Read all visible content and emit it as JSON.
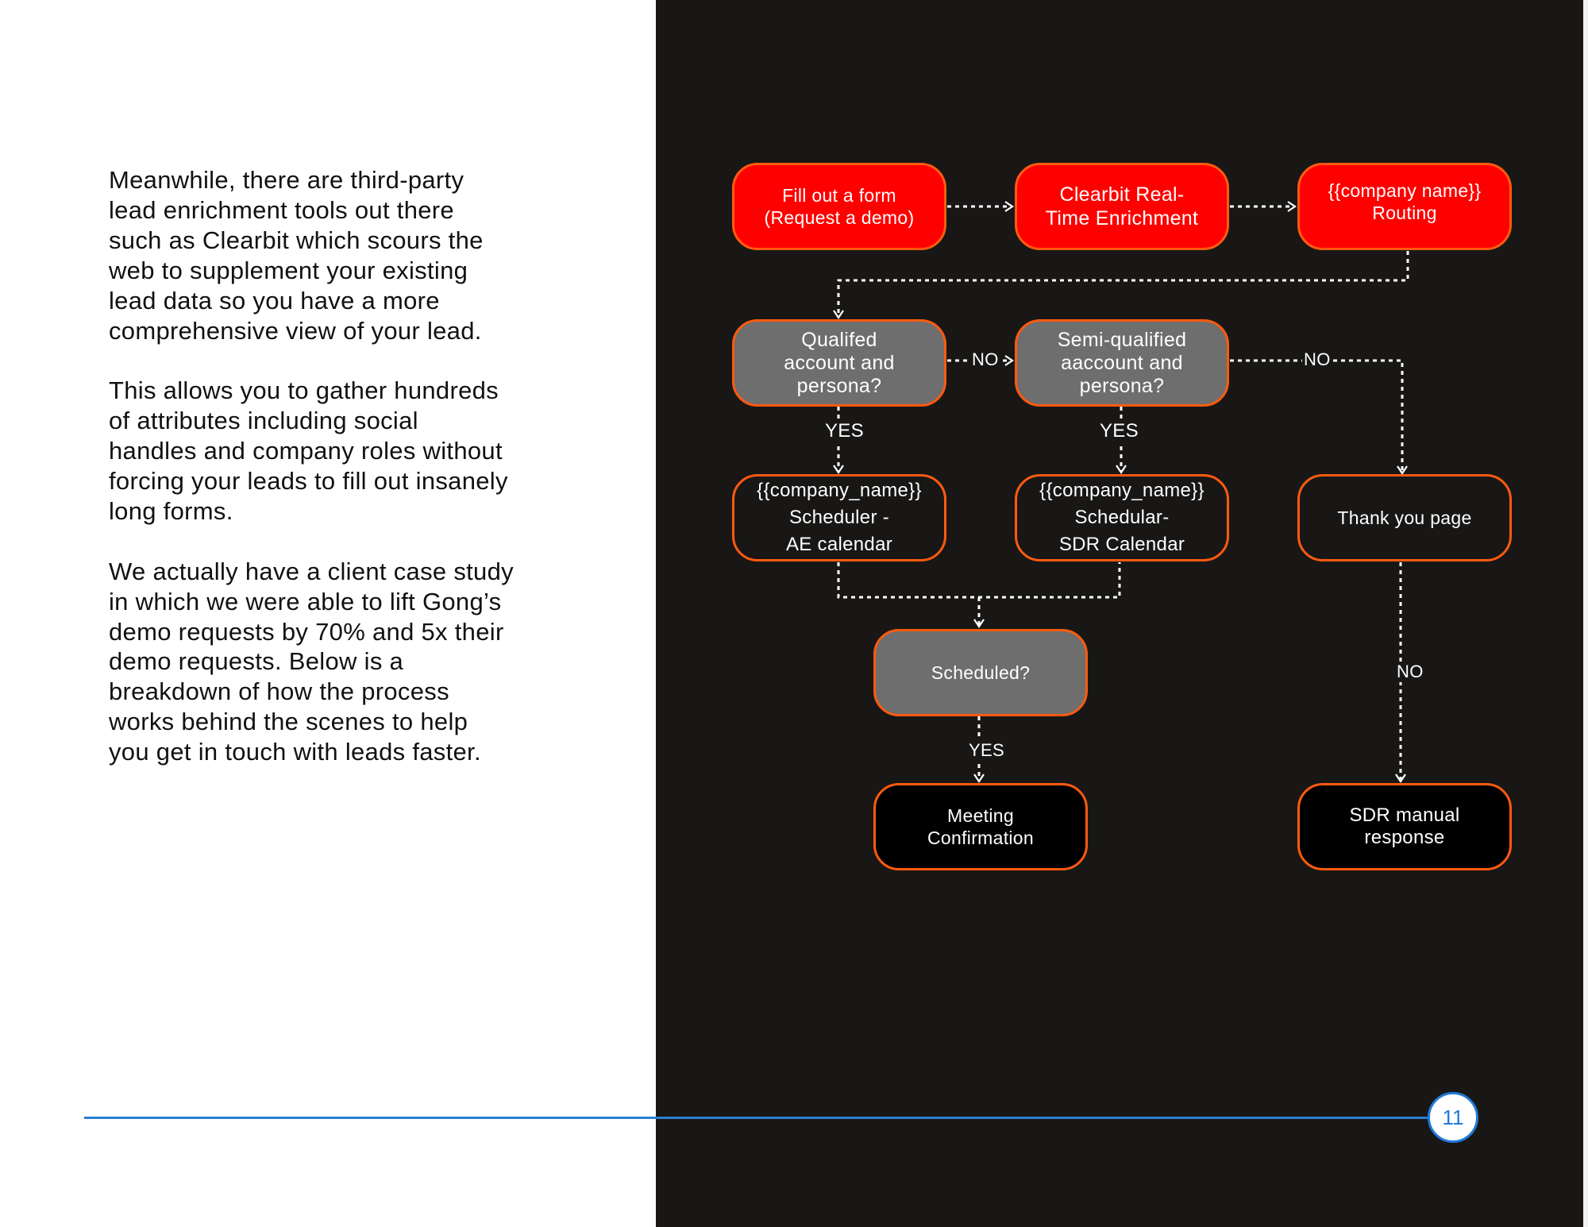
{
  "body_text": {
    "paragraphs": [
      [
        "Meanwhile, there are third-party",
        "lead enrichment tools out there",
        "such as Clearbit which scours the",
        "web to supplement your existing",
        "lead data so you have a more",
        "comprehensive view of your lead."
      ],
      [
        "This allows you to gather hundreds",
        "of attributes including social",
        "handles and company roles without",
        "forcing your leads to fill out insanely",
        "long forms."
      ],
      [
        "We actually have a client case study",
        "in which we were able to lift Gong’s",
        "demo requests by 70% and 5x their",
        "demo requests. Below is a",
        "breakdown of how the process",
        "works behind the scenes to help",
        "you get in touch with leads faster."
      ]
    ]
  },
  "flowchart": {
    "nodes": {
      "fill_form": [
        "Fill out a form",
        "(Request a demo)"
      ],
      "clearbit": [
        "Clearbit Real-",
        "Time Enrichment"
      ],
      "routing": [
        "{{company name}}",
        "Routing"
      ],
      "qualified": [
        "Qualifed",
        "account and",
        "persona?"
      ],
      "semi_qualified": [
        "Semi-qualified",
        "aaccount and",
        "persona?"
      ],
      "ae_scheduler": [
        "{{company_name}}",
        "Scheduler -",
        "AE calendar"
      ],
      "sdr_scheduler": [
        "{{company_name}}",
        "Schedular-",
        "SDR Calendar"
      ],
      "thank_you": [
        "Thank you page"
      ],
      "scheduled": [
        "Scheduled?"
      ],
      "meeting_confirmation": [
        "Meeting",
        "Confirmation"
      ],
      "sdr_manual": [
        "SDR manual",
        "response"
      ]
    },
    "edge_labels": {
      "qualified_no": "NO",
      "semi_no": "NO",
      "qualified_yes": "YES",
      "semi_yes": "YES",
      "scheduled_yes": "YES",
      "thankyou_no": "NO"
    },
    "colors": {
      "action_fill": "#ff0000",
      "decision_fill": "#6e6e6e",
      "border": "#ff5a0f",
      "background": "#181716"
    }
  },
  "footer": {
    "page_number": "11",
    "accent": "#1f7ad9"
  }
}
